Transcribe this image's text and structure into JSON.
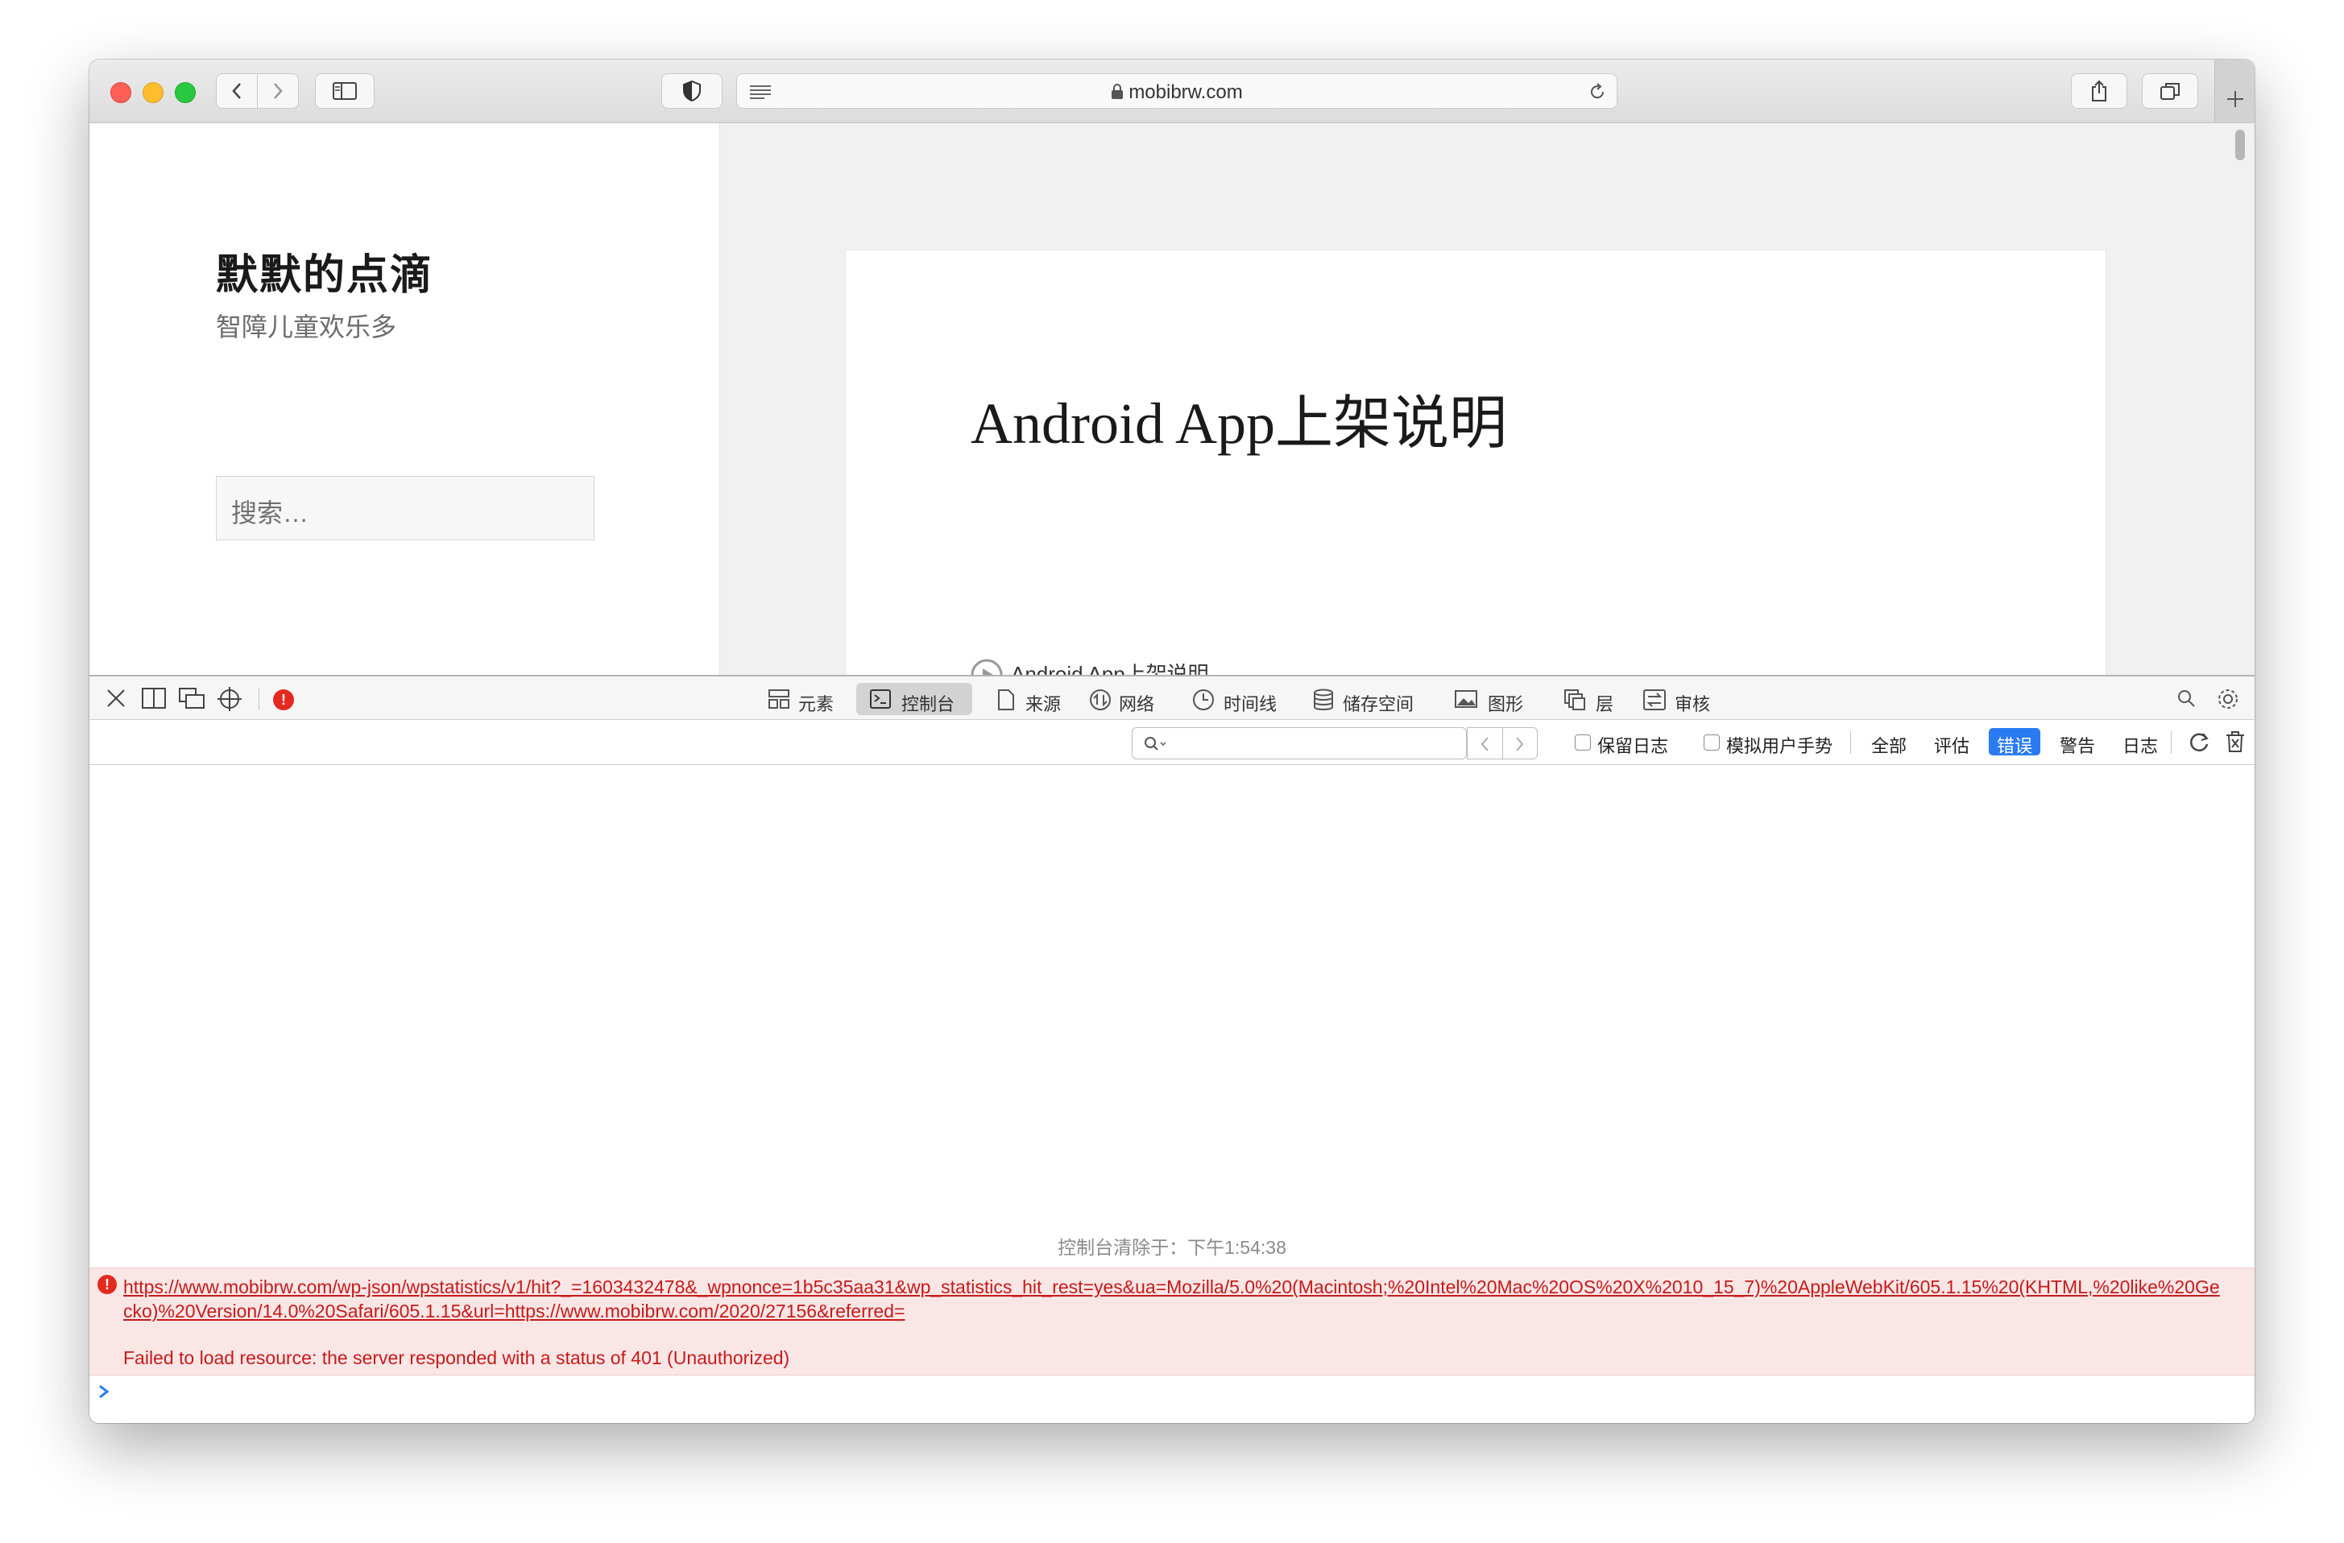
{
  "browser": {
    "url": "mobibrw.com"
  },
  "site": {
    "title": "默默的点滴",
    "description": "智障儿童欢乐多",
    "search_placeholder": "搜索…"
  },
  "post": {
    "title": "Android App上架说明",
    "clipped_text": "Android App上架说明"
  },
  "devtools": {
    "tabs": [
      "元素",
      "控制台",
      "来源",
      "网络",
      "时间线",
      "储存空间",
      "图形",
      "层",
      "审核"
    ],
    "active_tab": "控制台",
    "filter": {
      "preserve_log": "保留日志",
      "emulate_gesture": "模拟用户手势",
      "levels": [
        "全部",
        "评估",
        "错误",
        "警告",
        "日志"
      ],
      "active_level": "错误"
    }
  },
  "console": {
    "cleared_message": "控制台清除于：下午1:54:38",
    "error": {
      "url": "https://www.mobibrw.com/wp-json/wpstatistics/v1/hit?_=1603432478&_wpnonce=1b5c35aa31&wp_statistics_hit_rest=yes&ua=Mozilla/5.0%20(Macintosh;%20Intel%20Mac%20OS%20X%2010_15_7)%20AppleWebKit/605.1.15%20(KHTML,%20like%20Gecko)%20Version/14.0%20Safari/605.1.15&url=https://www.mobibrw.com/2020/27156&referred=",
      "message": "Failed to load resource: the server responded with a status of 401 (Unauthorized)"
    }
  },
  "colors": {
    "error_text": "#c61a1a",
    "error_bg": "#fbe6e6",
    "active_level": "#2a7bf2"
  }
}
